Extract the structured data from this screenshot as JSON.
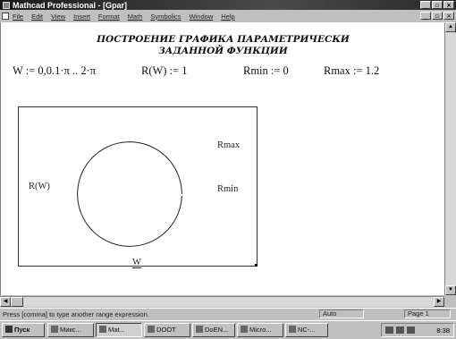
{
  "window": {
    "title": "Mathcad Professional - [Gpar]"
  },
  "menu": {
    "items": [
      "File",
      "Edit",
      "View",
      "Insert",
      "Format",
      "Math",
      "Symbolics",
      "Window",
      "Help"
    ]
  },
  "document": {
    "heading_line1": "ПОСТРОЕНИЕ ГРАФИКА ПАРАМЕТРИЧЕСКИ",
    "heading_line2": "ЗАДАННОЙ ФУНКЦИИ",
    "definitions": {
      "w_range": "W := 0,0.1·π .. 2·π",
      "r_def": "R(W) := 1",
      "rmin_def": "Rmin := 0",
      "rmax_def": "Rmax := 1.2"
    },
    "plot": {
      "rmax_label": "Rmax",
      "rmin_label": "Rmin",
      "y_label": "R(W)",
      "x_label": "W"
    }
  },
  "chart_data": {
    "type": "line",
    "plot_kind": "polar",
    "series": [
      {
        "r": 1,
        "theta_start": 0,
        "theta_end": 6.2832,
        "theta_step": 0.31416
      }
    ],
    "rlim": [
      0,
      1.2
    ],
    "grid": false
  },
  "status": {
    "message": "Press [comma] to type another range expression.",
    "mode": "Auto",
    "page": "Page 1"
  },
  "taskbar": {
    "start_label": "Пуск",
    "buttons": [
      "Микс...",
      "Mat...",
      "DOOT",
      "DoEN...",
      "Micro...",
      "NC-..."
    ],
    "clock": "8:38"
  }
}
